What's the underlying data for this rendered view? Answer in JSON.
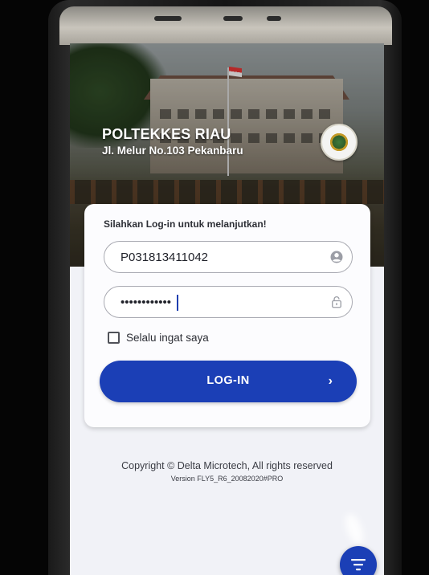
{
  "header": {
    "title": "POLTEKKES RIAU",
    "address": "Jl. Melur No.103 Pekanbaru",
    "emblem_icon": "institution-emblem-icon"
  },
  "login": {
    "prompt": "Silahkan Log-in untuk melanjutkan!",
    "username_value": "P031813411042",
    "username_icon": "user-account-icon",
    "password_value": "••••••••••••",
    "password_icon": "lock-icon",
    "remember_label": "Selalu ingat saya",
    "remember_checked": false,
    "button_label": "LOG-IN",
    "button_icon": "chevron-right-icon"
  },
  "footer": {
    "copyright": "Copyright © Delta Microtech, All rights reserved",
    "version": "Version FLY5_R6_20082020#PRO"
  },
  "fab": {
    "icon": "filter-icon"
  },
  "colors": {
    "primary": "#1b3fb6",
    "card_background": "#fcfcfe",
    "page_background": "#f1f2f7",
    "text": "#2d2f36"
  }
}
